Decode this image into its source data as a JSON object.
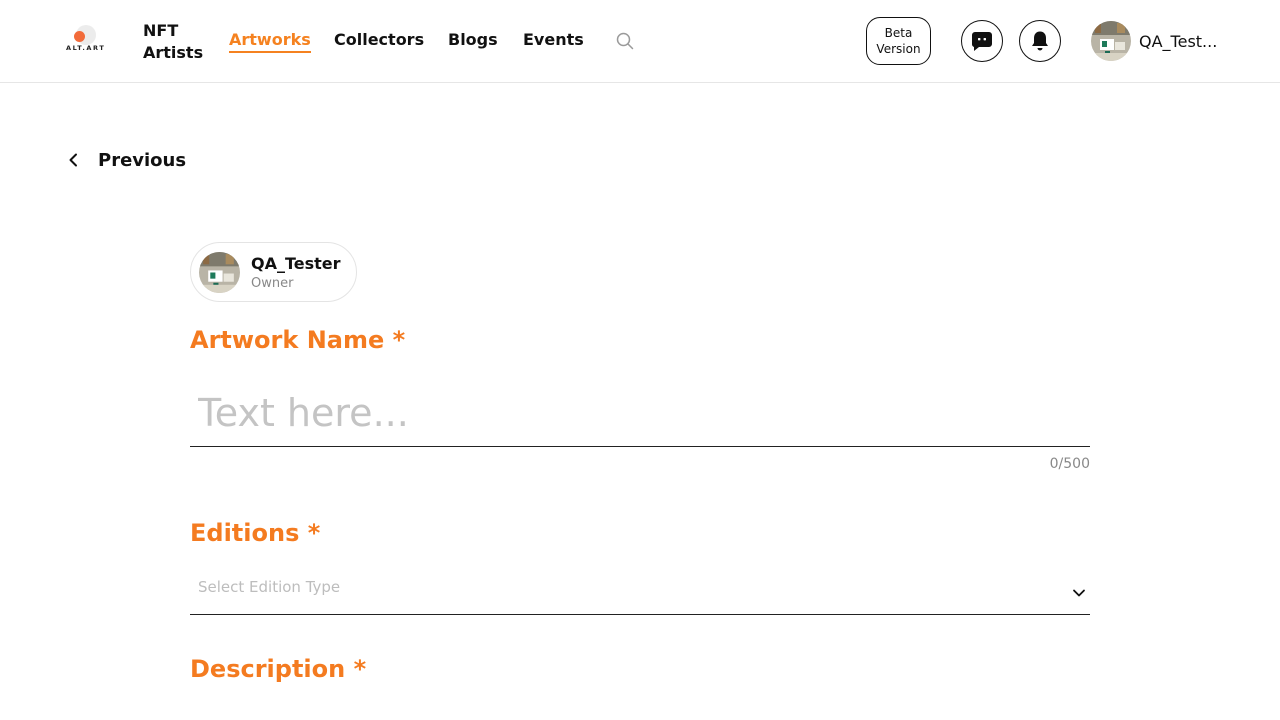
{
  "header": {
    "logo_text": "ALT.ART",
    "nav": [
      {
        "label": "NFT Artists"
      },
      {
        "label": "Artworks",
        "active": true
      },
      {
        "label": "Collectors"
      },
      {
        "label": "Blogs"
      },
      {
        "label": "Events"
      }
    ],
    "beta_label": "Beta Version",
    "username": "QA_Test..."
  },
  "back": {
    "label": "Previous"
  },
  "owner": {
    "name": "QA_Tester",
    "role": "Owner"
  },
  "form": {
    "artwork_name": {
      "label": "Artwork Name *",
      "placeholder": "Text here...",
      "value": "",
      "counter": "0/500"
    },
    "editions": {
      "label": "Editions *",
      "placeholder": "Select Edition Type"
    },
    "description": {
      "label": "Description *"
    }
  },
  "colors": {
    "accent": "#f47b20",
    "border": "#222222",
    "muted": "#888888"
  }
}
